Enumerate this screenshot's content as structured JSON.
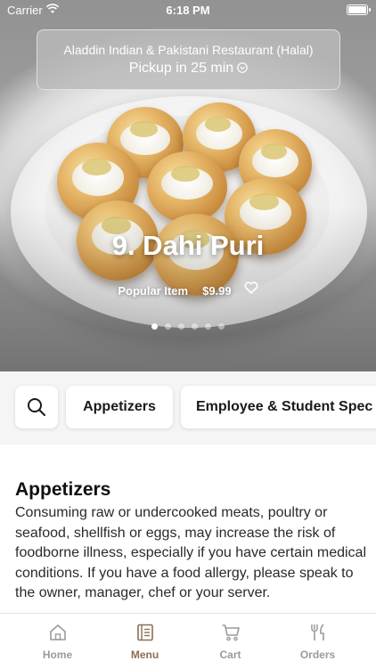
{
  "status_bar": {
    "carrier": "Carrier",
    "time": "6:18 PM"
  },
  "header": {
    "restaurant": "Aladdin Indian & Pakistani Restaurant (Halal)",
    "pickup": "Pickup in 25 min"
  },
  "hero": {
    "dish": "9. Dahi Puri",
    "tag": "Popular Item",
    "price": "$9.99",
    "carousel": {
      "count": 6,
      "active_index": 0
    }
  },
  "categories": {
    "search_icon": "search-icon",
    "items": [
      "Appetizers",
      "Employee & Student Spec"
    ]
  },
  "section": {
    "title": "Appetizers",
    "description": "Consuming raw or undercooked meats, poultry or seafood, shellfish or eggs, may increase the risk of foodborne illness, especially if you have certain medical conditions. If you have a food allergy, please speak to the owner, manager, chef or your server."
  },
  "tabbar": {
    "items": [
      {
        "label": "Home",
        "icon": "home-icon"
      },
      {
        "label": "Menu",
        "icon": "menu-icon"
      },
      {
        "label": "Cart",
        "icon": "cart-icon"
      },
      {
        "label": "Orders",
        "icon": "orders-icon"
      }
    ],
    "active": "Menu"
  },
  "colors": {
    "accent": "#8c6e55",
    "inactive": "#9a9a9a"
  }
}
